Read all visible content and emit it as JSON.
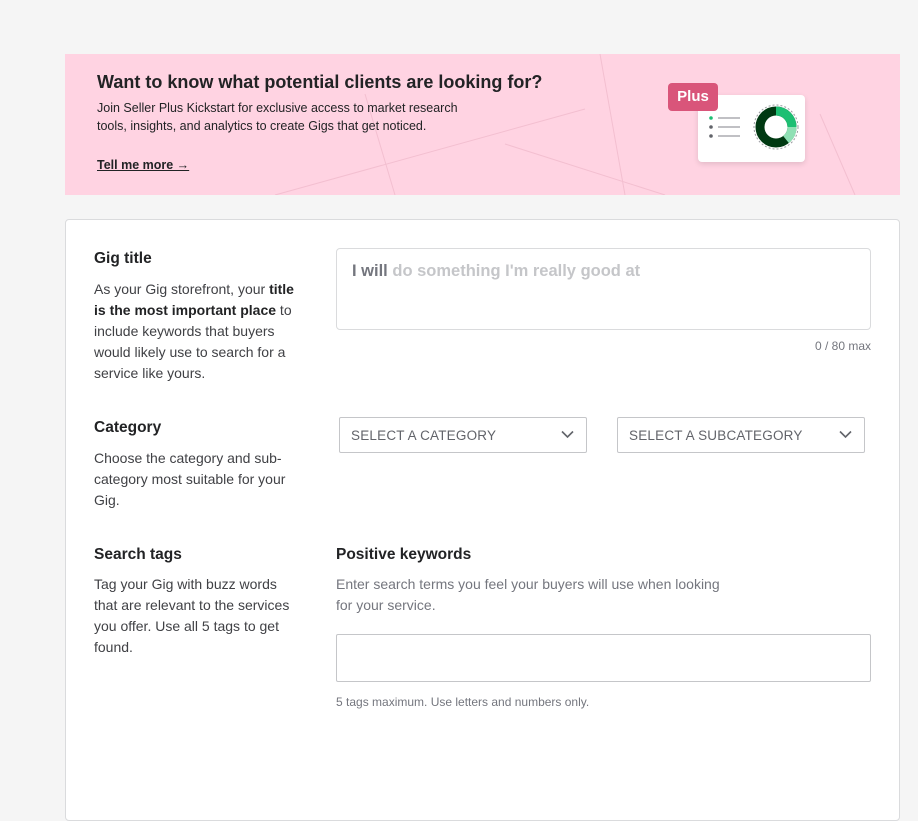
{
  "banner": {
    "title": "Want to know what potential clients are looking for?",
    "description": "Join Seller Plus Kickstart for exclusive access to market research tools, insights, and analytics to create Gigs that get noticed.",
    "link": "Tell me more →",
    "badge": "Plus",
    "background": "#ffd3e2",
    "badge_color": "#d9557a"
  },
  "gig_title": {
    "label": "Gig title",
    "desc_before": "As your Gig storefront, your ",
    "desc_bold": "title is the most important place",
    "desc_after": " to include keywords that buyers would likely use to search for a service like yours.",
    "prefix": "I will",
    "placeholder": "do something I'm really good at",
    "counter": "0 / 80 max"
  },
  "category": {
    "label": "Category",
    "description": "Choose the category and sub-category most suitable for your Gig.",
    "select_category": "SELECT A CATEGORY",
    "select_subcategory": "SELECT A SUBCATEGORY"
  },
  "search_tags": {
    "label": "Search tags",
    "description": "Tag your Gig with buzz words that are relevant to the services you offer. Use all 5 tags to get found.",
    "keywords_label": "Positive keywords",
    "keywords_description": "Enter search terms you feel your buyers will use when looking for your service.",
    "hint": "5 tags maximum. Use letters and numbers only."
  }
}
